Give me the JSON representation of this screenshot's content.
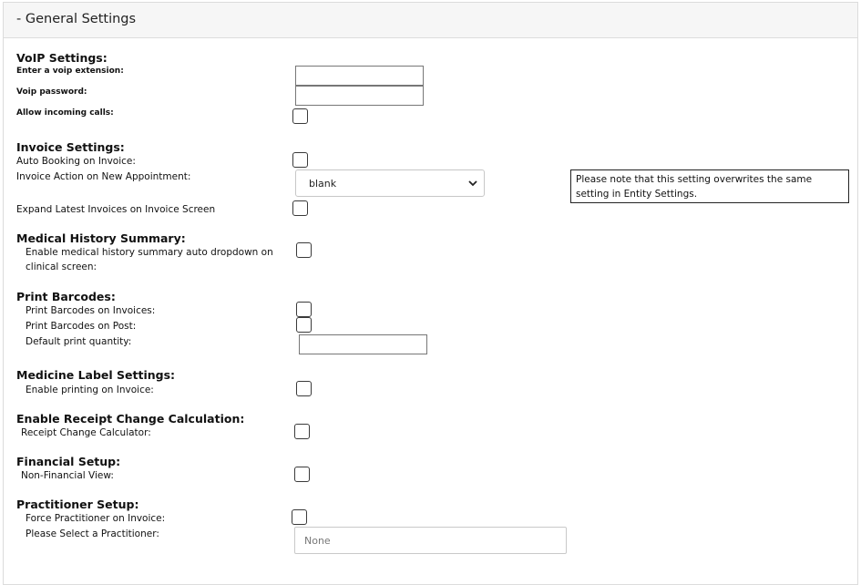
{
  "panel": {
    "title": "- General Settings"
  },
  "voip": {
    "heading": "VoIP Settings:",
    "extension_label": "Enter a voip extension:",
    "extension_value": "",
    "password_label": "Voip password:",
    "password_value": "",
    "incoming_label": "Allow incoming calls:",
    "incoming_checked": false
  },
  "invoice": {
    "heading": "Invoice Settings:",
    "auto_booking_label": "Auto Booking on Invoice:",
    "action_label": "Invoice Action on New Appointment:",
    "action_selected": "blank",
    "action_note": "Please note that this setting overwrites the same setting in Entity Settings.",
    "expand_label": "Expand Latest Invoices on Invoice Screen"
  },
  "medical": {
    "heading": "Medical History Summary:",
    "auto_dropdown_label": "Enable medical history summary auto dropdown on clinical screen:"
  },
  "barcodes": {
    "heading": "Print Barcodes:",
    "invoices_label": "Print Barcodes on Invoices:",
    "post_label": "Print Barcodes on Post:",
    "quantity_label": "Default print quantity:",
    "quantity_value": ""
  },
  "medicine_label": {
    "heading": "Medicine Label Settings:",
    "printing_label": "Enable printing on Invoice:"
  },
  "receipt": {
    "heading": "Enable Receipt Change Calculation:",
    "calculator_label": "Receipt Change Calculator:"
  },
  "financial": {
    "heading": "Financial Setup:",
    "non_financial_label": "Non-Financial View:"
  },
  "practitioner": {
    "heading": "Practitioner Setup:",
    "force_label": "Force Practitioner on Invoice:",
    "select_label": "Please Select a Practitioner:",
    "select_value": "None"
  }
}
